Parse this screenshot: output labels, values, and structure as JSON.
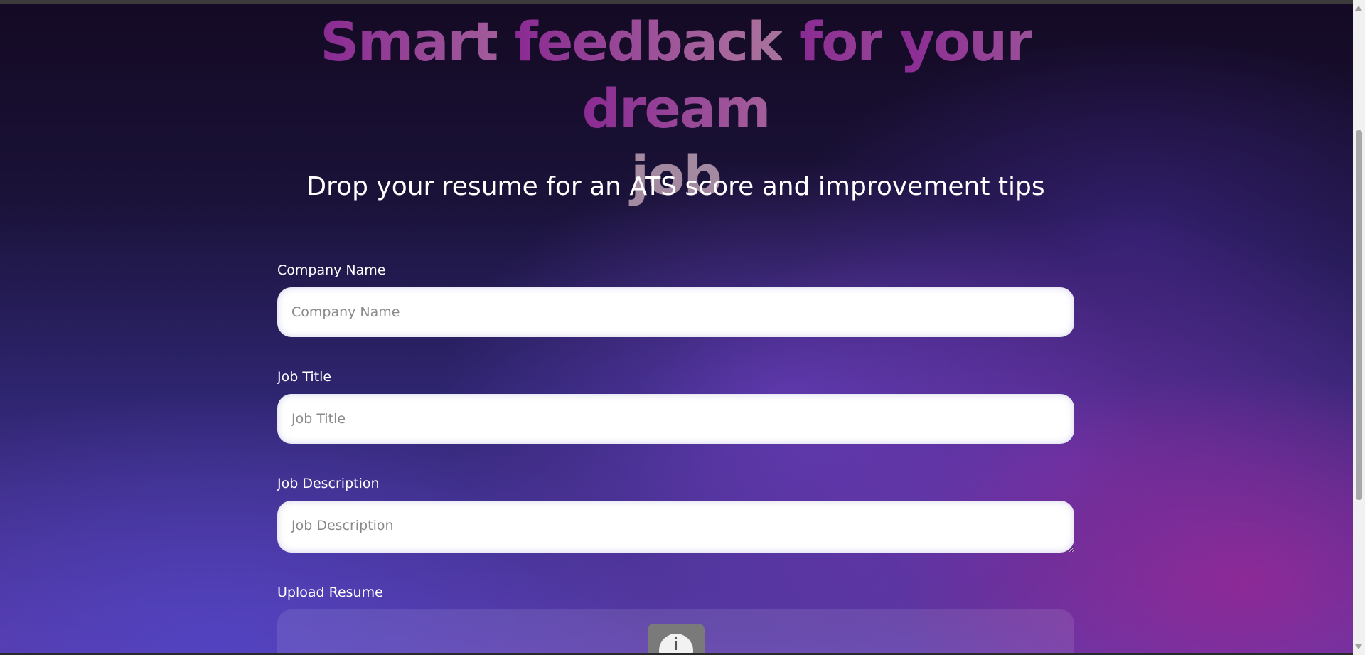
{
  "hero": {
    "title_words": [
      "Smart",
      "feedback",
      "for",
      "your",
      "dream"
    ],
    "title_last": "job",
    "subtitle": "Drop your resume for an ATS score and improvement tips"
  },
  "form": {
    "company": {
      "label": "Company Name",
      "placeholder": "Company Name"
    },
    "job_title": {
      "label": "Job Title",
      "placeholder": "Job Title"
    },
    "job_description": {
      "label": "Job Description",
      "placeholder": "Job Description"
    },
    "upload": {
      "label": "Upload Resume",
      "icon": "info-icon"
    }
  },
  "colors": {
    "title_gradient_start": "#8a2a93",
    "title_gradient_end": "#1d2ba3",
    "background_dark": "#140a24",
    "background_purple": "#5a3aa8",
    "input_bg": "#ffffff"
  }
}
